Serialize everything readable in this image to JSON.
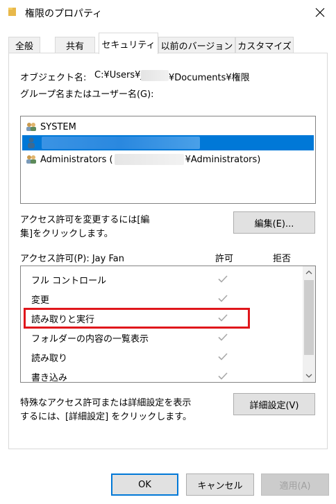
{
  "window": {
    "title": "権限のプロパティ"
  },
  "tabs": [
    {
      "label": "全般",
      "active": false
    },
    {
      "label": "共有",
      "active": false
    },
    {
      "label": "セキュリティ",
      "active": true
    },
    {
      "label": "以前のバージョン",
      "active": false
    },
    {
      "label": "カスタマイズ",
      "active": false
    }
  ],
  "object": {
    "label": "オブジェクト名:",
    "path_prefix": "C:¥Users¥j",
    "path_suffix": "¥Documents¥権限"
  },
  "groups": {
    "label": "グループ名またはユーザー名(G):",
    "items": [
      {
        "name": "SYSTEM",
        "icon": "users-group-icon",
        "selected": false
      },
      {
        "name": "",
        "icon": "user-icon",
        "selected": true
      },
      {
        "name": "Administrators (",
        "suffix": "¥Administrators)",
        "icon": "users-group-icon",
        "selected": false
      }
    ]
  },
  "change_permissions": {
    "text_line1": "アクセス許可を変更するには[編",
    "text_line2": "集]をクリックします。",
    "edit_button": "編集(E)..."
  },
  "permissions": {
    "header": "アクセス許可(P): Jay Fan",
    "allow_header": "許可",
    "deny_header": "拒否",
    "rows": [
      {
        "name": "フル コントロール",
        "allow": true,
        "deny": false
      },
      {
        "name": "変更",
        "allow": true,
        "deny": false
      },
      {
        "name": "読み取りと実行",
        "allow": true,
        "deny": false
      },
      {
        "name": "フォルダーの内容の一覧表示",
        "allow": true,
        "deny": false
      },
      {
        "name": "読み取り",
        "allow": true,
        "deny": false
      },
      {
        "name": "書き込み",
        "allow": true,
        "deny": false
      }
    ]
  },
  "advanced": {
    "text_line1": "特殊なアクセス許可または詳細設定を表示",
    "text_line2": "するには、[詳細設定] をクリックします。",
    "button": "詳細設定(V)"
  },
  "footer": {
    "ok": "OK",
    "cancel": "キャンセル",
    "apply": "適用(A)"
  },
  "colors": {
    "selection": "#0078d7",
    "highlight_box": "#e0161b",
    "check_gray": "#a8a8a8"
  }
}
